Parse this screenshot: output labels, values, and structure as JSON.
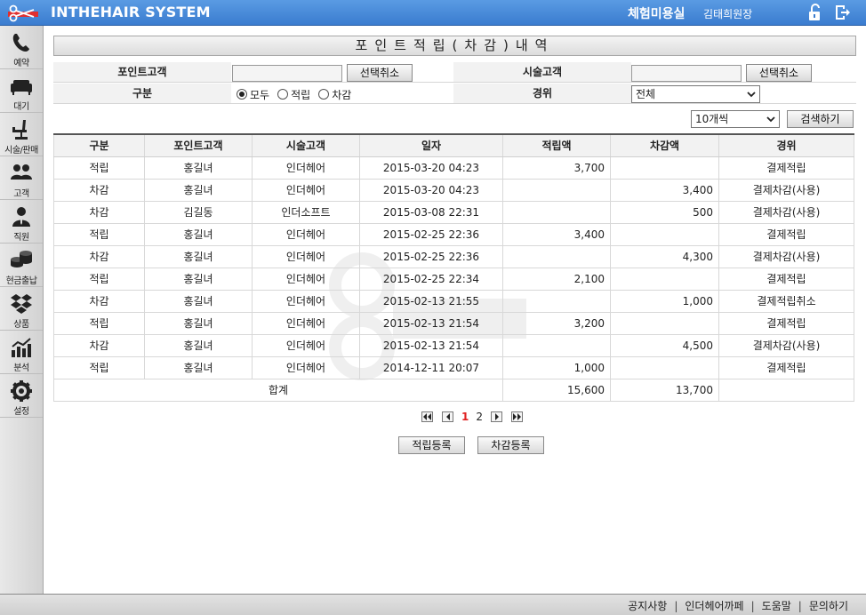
{
  "header": {
    "app_title": "INTHEHAIR SYSTEM",
    "shop_name": "체험미용실",
    "user_name": "김태희원장"
  },
  "sidebar": {
    "items": [
      {
        "label": "예약",
        "icon": "phone-icon"
      },
      {
        "label": "대기",
        "icon": "sofa-icon"
      },
      {
        "label": "시술/판매",
        "icon": "salon-chair-icon"
      },
      {
        "label": "고객",
        "icon": "customers-icon"
      },
      {
        "label": "직원",
        "icon": "staff-icon"
      },
      {
        "label": "현금출납",
        "icon": "coins-icon"
      },
      {
        "label": "상품",
        "icon": "dropbox-icon"
      },
      {
        "label": "분석",
        "icon": "analytics-chart-icon"
      },
      {
        "label": "설정",
        "icon": "gear-icon"
      }
    ]
  },
  "page": {
    "title": "포인트적립(차감)내역"
  },
  "filters": {
    "point_customer_label": "포인트고객",
    "point_customer_value": "",
    "point_customer_clear": "선택취소",
    "service_customer_label": "시술고객",
    "service_customer_value": "",
    "service_customer_clear": "선택취소",
    "type_label": "구분",
    "type_options": [
      "모두",
      "적립",
      "차감"
    ],
    "type_selected": "모두",
    "route_label": "경위",
    "route_selected": "전체",
    "page_size_selected": "10개씩",
    "search_button": "검색하기"
  },
  "table": {
    "columns": [
      "구분",
      "포인트고객",
      "시술고객",
      "일자",
      "적립액",
      "차감액",
      "경위"
    ],
    "rows": [
      {
        "type": "적립",
        "point_customer": "홍길녀",
        "service_customer": "인더헤어",
        "date": "2015-03-20 04:23",
        "earned": "3,700",
        "deducted": "",
        "route": "결제적립"
      },
      {
        "type": "차감",
        "point_customer": "홍길녀",
        "service_customer": "인더헤어",
        "date": "2015-03-20 04:23",
        "earned": "",
        "deducted": "3,400",
        "route": "결제차감(사용)"
      },
      {
        "type": "차감",
        "point_customer": "김길동",
        "service_customer": "인더소프트",
        "date": "2015-03-08 22:31",
        "earned": "",
        "deducted": "500",
        "route": "결제차감(사용)"
      },
      {
        "type": "적립",
        "point_customer": "홍길녀",
        "service_customer": "인더헤어",
        "date": "2015-02-25 22:36",
        "earned": "3,400",
        "deducted": "",
        "route": "결제적립"
      },
      {
        "type": "차감",
        "point_customer": "홍길녀",
        "service_customer": "인더헤어",
        "date": "2015-02-25 22:36",
        "earned": "",
        "deducted": "4,300",
        "route": "결제차감(사용)"
      },
      {
        "type": "적립",
        "point_customer": "홍길녀",
        "service_customer": "인더헤어",
        "date": "2015-02-25 22:34",
        "earned": "2,100",
        "deducted": "",
        "route": "결제적립"
      },
      {
        "type": "차감",
        "point_customer": "홍길녀",
        "service_customer": "인더헤어",
        "date": "2015-02-13 21:55",
        "earned": "",
        "deducted": "1,000",
        "route": "결제적립취소"
      },
      {
        "type": "적립",
        "point_customer": "홍길녀",
        "service_customer": "인더헤어",
        "date": "2015-02-13 21:54",
        "earned": "3,200",
        "deducted": "",
        "route": "결제적립"
      },
      {
        "type": "차감",
        "point_customer": "홍길녀",
        "service_customer": "인더헤어",
        "date": "2015-02-13 21:54",
        "earned": "",
        "deducted": "4,500",
        "route": "결제차감(사용)"
      },
      {
        "type": "적립",
        "point_customer": "홍길녀",
        "service_customer": "인더헤어",
        "date": "2014-12-11 20:07",
        "earned": "1,000",
        "deducted": "",
        "route": "결제적립"
      }
    ],
    "total_label": "합계",
    "total_earned": "15,600",
    "total_deducted": "13,700"
  },
  "pagination": {
    "pages": [
      "1",
      "2"
    ],
    "current": "1"
  },
  "actions": {
    "earn_register": "적립등록",
    "deduct_register": "차감등록"
  },
  "footer": {
    "links": [
      "공지사항",
      "인더헤어까페",
      "도움말",
      "문의하기"
    ]
  },
  "colors": {
    "header_blue": "#3a7ccf",
    "active_page": "#e02020"
  }
}
